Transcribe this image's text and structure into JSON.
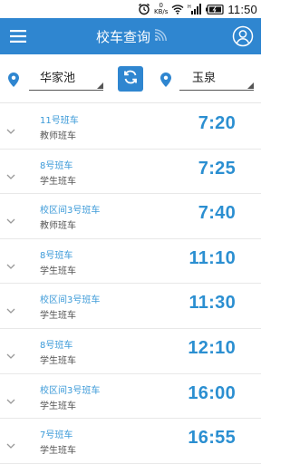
{
  "status_bar": {
    "net_speed_value": "0",
    "net_speed_unit": "KB/s",
    "network_type": "H",
    "time": "11:50"
  },
  "app_bar": {
    "title": "校车查询",
    "menu_icon": "hamburger-menu-icon",
    "user_icon": "user-profile-icon",
    "title_icon": "wifi-signal-icon"
  },
  "selector": {
    "from_station": "华家池",
    "to_station": "玉泉",
    "swap_icon": "refresh-swap-icon"
  },
  "schedule": [
    {
      "bus": "11号班车",
      "type": "教师班车",
      "time": "7:20"
    },
    {
      "bus": "8号班车",
      "type": "学生班车",
      "time": "7:25"
    },
    {
      "bus": "校区间3号班车",
      "type": "教师班车",
      "time": "7:40"
    },
    {
      "bus": "8号班车",
      "type": "学生班车",
      "time": "11:10"
    },
    {
      "bus": "校区间3号班车",
      "type": "学生班车",
      "time": "11:30"
    },
    {
      "bus": "8号班车",
      "type": "学生班车",
      "time": "12:10"
    },
    {
      "bus": "校区间3号班车",
      "type": "学生班车",
      "time": "16:00"
    },
    {
      "bus": "7号班车",
      "type": "学生班车",
      "time": "16:55"
    }
  ],
  "colors": {
    "primary": "#2f86d0",
    "time_text": "#2b8fd1",
    "bus_text": "#3b9ad8"
  }
}
